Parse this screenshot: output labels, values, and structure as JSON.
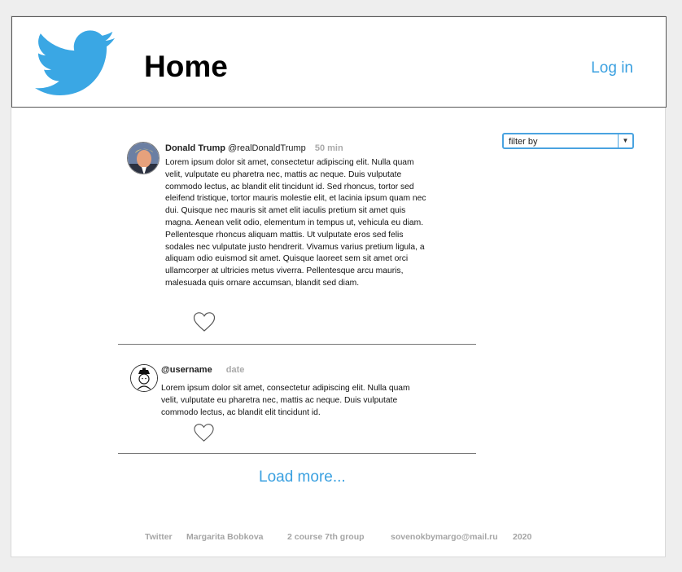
{
  "header": {
    "logo_icon": "twitter-bird-icon",
    "title": "Home",
    "login_label": "Log in"
  },
  "filter": {
    "selected": "filter by",
    "arrow_icon": "triangle-down-icon"
  },
  "tweets": [
    {
      "name": "Donald Trump",
      "handle": "@realDonaldTrump",
      "date": "50 min",
      "text": "Lorem ipsum dolor sit amet, consectetur adipiscing elit. Nulla quam velit, vulputate eu pharetra nec, mattis ac neque. Duis vulputate commodo lectus, ac blandit elit tincidunt id. Sed rhoncus, tortor sed eleifend tristique, tortor mauris molestie elit, et lacinia ipsum quam nec dui. Quisque nec mauris sit amet elit iaculis pretium sit amet quis magna. Aenean velit odio, elementum in tempus ut, vehicula eu diam. Pellentesque rhoncus aliquam mattis. Ut vulputate eros sed felis sodales nec vulputate justo hendrerit. Vivamus varius pretium ligula, a aliquam odio euismod sit amet. Quisque laoreet sem sit amet orci ullamcorper at ultricies metus viverra. Pellentesque arcu mauris, malesuada quis ornare accumsan, blandit sed diam.",
      "avatar_icon": "user-photo-avatar",
      "like_icon": "heart-outline-icon"
    },
    {
      "name": "@username",
      "date": "date",
      "text": "Lorem ipsum dolor sit amet, consectetur adipiscing elit. Nulla quam velit, vulputate eu pharetra nec, mattis ac neque. Duis vulputate commodo lectus, ac blandit elit tincidunt id.",
      "avatar_icon": "default-user-avatar-icon",
      "like_icon": "heart-outline-icon"
    }
  ],
  "load_more_label": "Load more...",
  "footer": {
    "site": "Twitter",
    "author": "Margarita Bobkova",
    "group": "2 course 7th group",
    "email": "sovenokbymargo@mail.ru",
    "year": "2020"
  },
  "colors": {
    "accent": "#3aa0e0",
    "page_bg": "#eeeeee",
    "muted_text": "#a5a5a5"
  }
}
